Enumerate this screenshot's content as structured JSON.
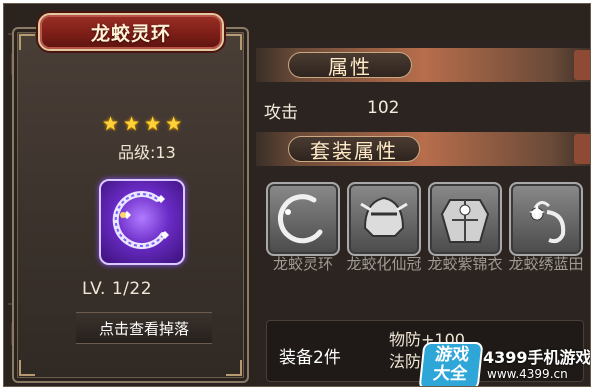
{
  "item": {
    "title": "龙蛟灵环",
    "star_count": 4,
    "grade_label": "品级:",
    "grade_value": "13",
    "level_text": "LV. 1/22",
    "drop_button": "点击查看掉落"
  },
  "attributes": {
    "header": "属性",
    "stats": [
      {
        "name": "攻击",
        "value": "102"
      }
    ]
  },
  "set_attributes": {
    "header": "套装属性",
    "pieces": [
      {
        "name": "龙蛟灵环",
        "icon": "ring-icon"
      },
      {
        "name": "龙蛟化仙冠",
        "icon": "helmet-icon"
      },
      {
        "name": "龙蛟紫锦衣",
        "icon": "armor-icon"
      },
      {
        "name": "龙蛟绣蓝田",
        "icon": "talisman-icon"
      }
    ],
    "bonus_label": "装备2件",
    "bonus_stats": [
      "物防+100",
      "法防"
    ]
  },
  "watermark": {
    "logo_line1": "游戏",
    "logo_line2": "大全",
    "title": "4399手机游戏",
    "url": "www.4399.cn"
  },
  "colors": {
    "star": "#ffd23a",
    "title_plate": "#7a1d17",
    "item_glow": "#8b4cff",
    "section_bar": "#b76e4c"
  }
}
